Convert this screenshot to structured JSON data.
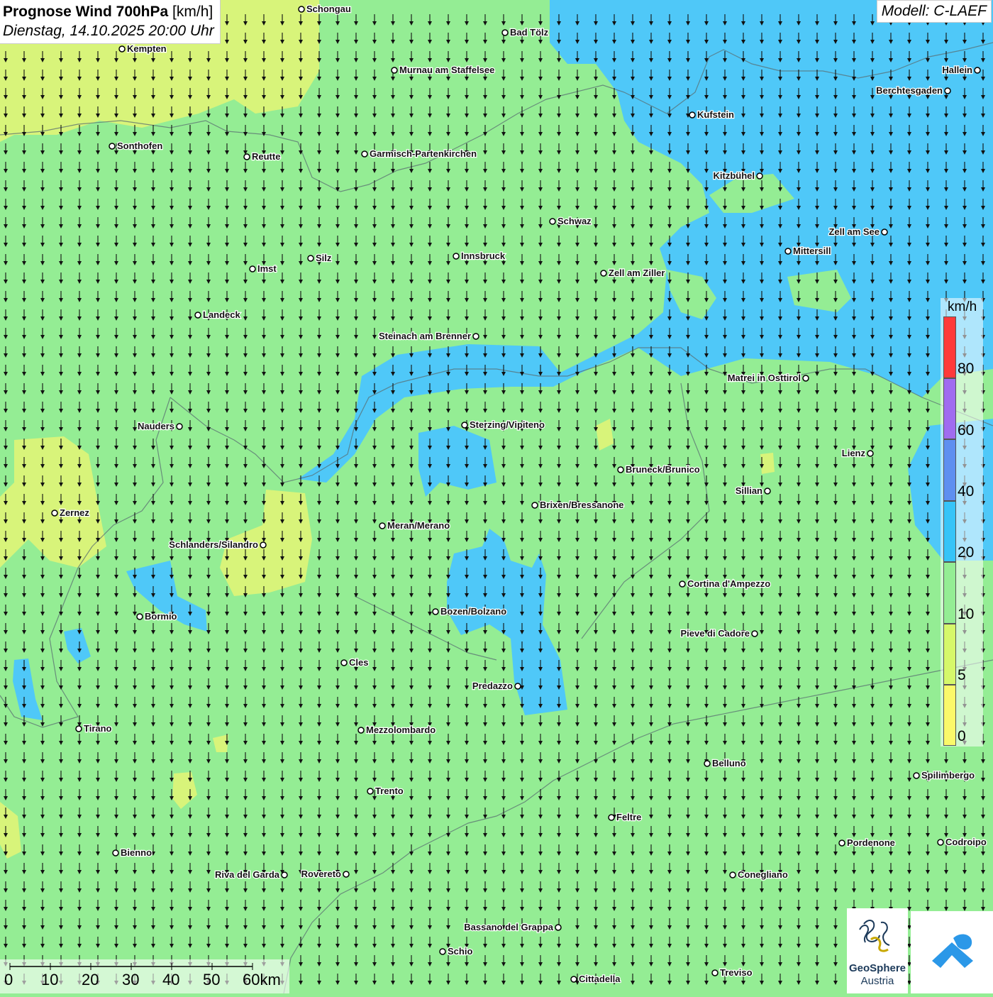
{
  "header": {
    "title_bold": "Prognose Wind 700hPa",
    "title_unit": "[km/h]",
    "datetime": "Dienstag, 14.10.2025 20:00 Uhr",
    "model": "Modell: C-LAEF"
  },
  "legend": {
    "unit": "km/h",
    "bands": [
      {
        "label": "80",
        "color": "#ff3a3a"
      },
      {
        "label": "60",
        "color": "#a06cf0"
      },
      {
        "label": "40",
        "color": "#5e8ff0"
      },
      {
        "label": "20",
        "color": "#36c4f8"
      },
      {
        "label": "10",
        "color": "#94ed94"
      },
      {
        "label": "5",
        "color": "#d6f86a"
      },
      {
        "label": "0",
        "color": "#fbf96a"
      }
    ]
  },
  "scale": {
    "ticks": [
      "0",
      "10",
      "20",
      "30",
      "40",
      "50",
      "60km"
    ]
  },
  "logo": {
    "line1": "GeoSphere",
    "line2": "Austria"
  },
  "cities": [
    {
      "name": "Schongau",
      "side": "r"
    },
    {
      "name": "Bad Tölz",
      "side": "r"
    },
    {
      "name": "Kempten",
      "side": "r"
    },
    {
      "name": "Murnau am Staffelsee",
      "side": "r"
    },
    {
      "name": "Hallein",
      "side": "l"
    },
    {
      "name": "Berchtesgaden",
      "side": "l"
    },
    {
      "name": "Kufstein",
      "side": "r"
    },
    {
      "name": "Sonthofen",
      "side": "r"
    },
    {
      "name": "Reutte",
      "side": "r"
    },
    {
      "name": "Garmisch-Partenkirchen",
      "side": "r"
    },
    {
      "name": "Kitzbühel",
      "side": "l"
    },
    {
      "name": "Schwaz",
      "side": "r"
    },
    {
      "name": "Zell am See",
      "side": "l"
    },
    {
      "name": "Mittersill",
      "side": "r"
    },
    {
      "name": "Silz",
      "side": "r"
    },
    {
      "name": "Innsbruck",
      "side": "r"
    },
    {
      "name": "Imst",
      "side": "r"
    },
    {
      "name": "Zell am Ziller",
      "side": "r"
    },
    {
      "name": "Landeck",
      "side": "r"
    },
    {
      "name": "Steinach am Brenner",
      "side": "l"
    },
    {
      "name": "Matrei in Osttirol",
      "side": "l"
    },
    {
      "name": "Nauders",
      "side": "l"
    },
    {
      "name": "Sterzing/Vipiteno",
      "side": "r"
    },
    {
      "name": "Lienz",
      "side": "l"
    },
    {
      "name": "Bruneck/Brunico",
      "side": "r"
    },
    {
      "name": "Sillian",
      "side": "l"
    },
    {
      "name": "Zernez",
      "side": "r"
    },
    {
      "name": "Brixen/Bressanone",
      "side": "r"
    },
    {
      "name": "Meran/Merano",
      "side": "r"
    },
    {
      "name": "Schlanders/Silandro",
      "side": "l"
    },
    {
      "name": "Cortina d'Ampezzo",
      "side": "r"
    },
    {
      "name": "Bozen/Bolzano",
      "side": "r"
    },
    {
      "name": "Bormio",
      "side": "r"
    },
    {
      "name": "Pieve di Cadore",
      "side": "l"
    },
    {
      "name": "Cles",
      "side": "r"
    },
    {
      "name": "Predazzo",
      "side": "l"
    },
    {
      "name": "Tirano",
      "side": "r"
    },
    {
      "name": "Mezzolombardo",
      "side": "r"
    },
    {
      "name": "Belluno",
      "side": "r"
    },
    {
      "name": "Spilimbergo",
      "side": "r"
    },
    {
      "name": "Trento",
      "side": "r"
    },
    {
      "name": "Feltre",
      "side": "r"
    },
    {
      "name": "Pordenone",
      "side": "r"
    },
    {
      "name": "Codroipo",
      "side": "r"
    },
    {
      "name": "Bienno",
      "side": "r"
    },
    {
      "name": "Riva del Garda",
      "side": "l"
    },
    {
      "name": "Rovereto",
      "side": "l"
    },
    {
      "name": "Conegliano",
      "side": "r"
    },
    {
      "name": "Bassano del Grappa",
      "side": "l"
    },
    {
      "name": "Schio",
      "side": "r"
    },
    {
      "name": "Treviso",
      "side": "r"
    },
    {
      "name": "Cittadella",
      "side": "r"
    }
  ]
}
